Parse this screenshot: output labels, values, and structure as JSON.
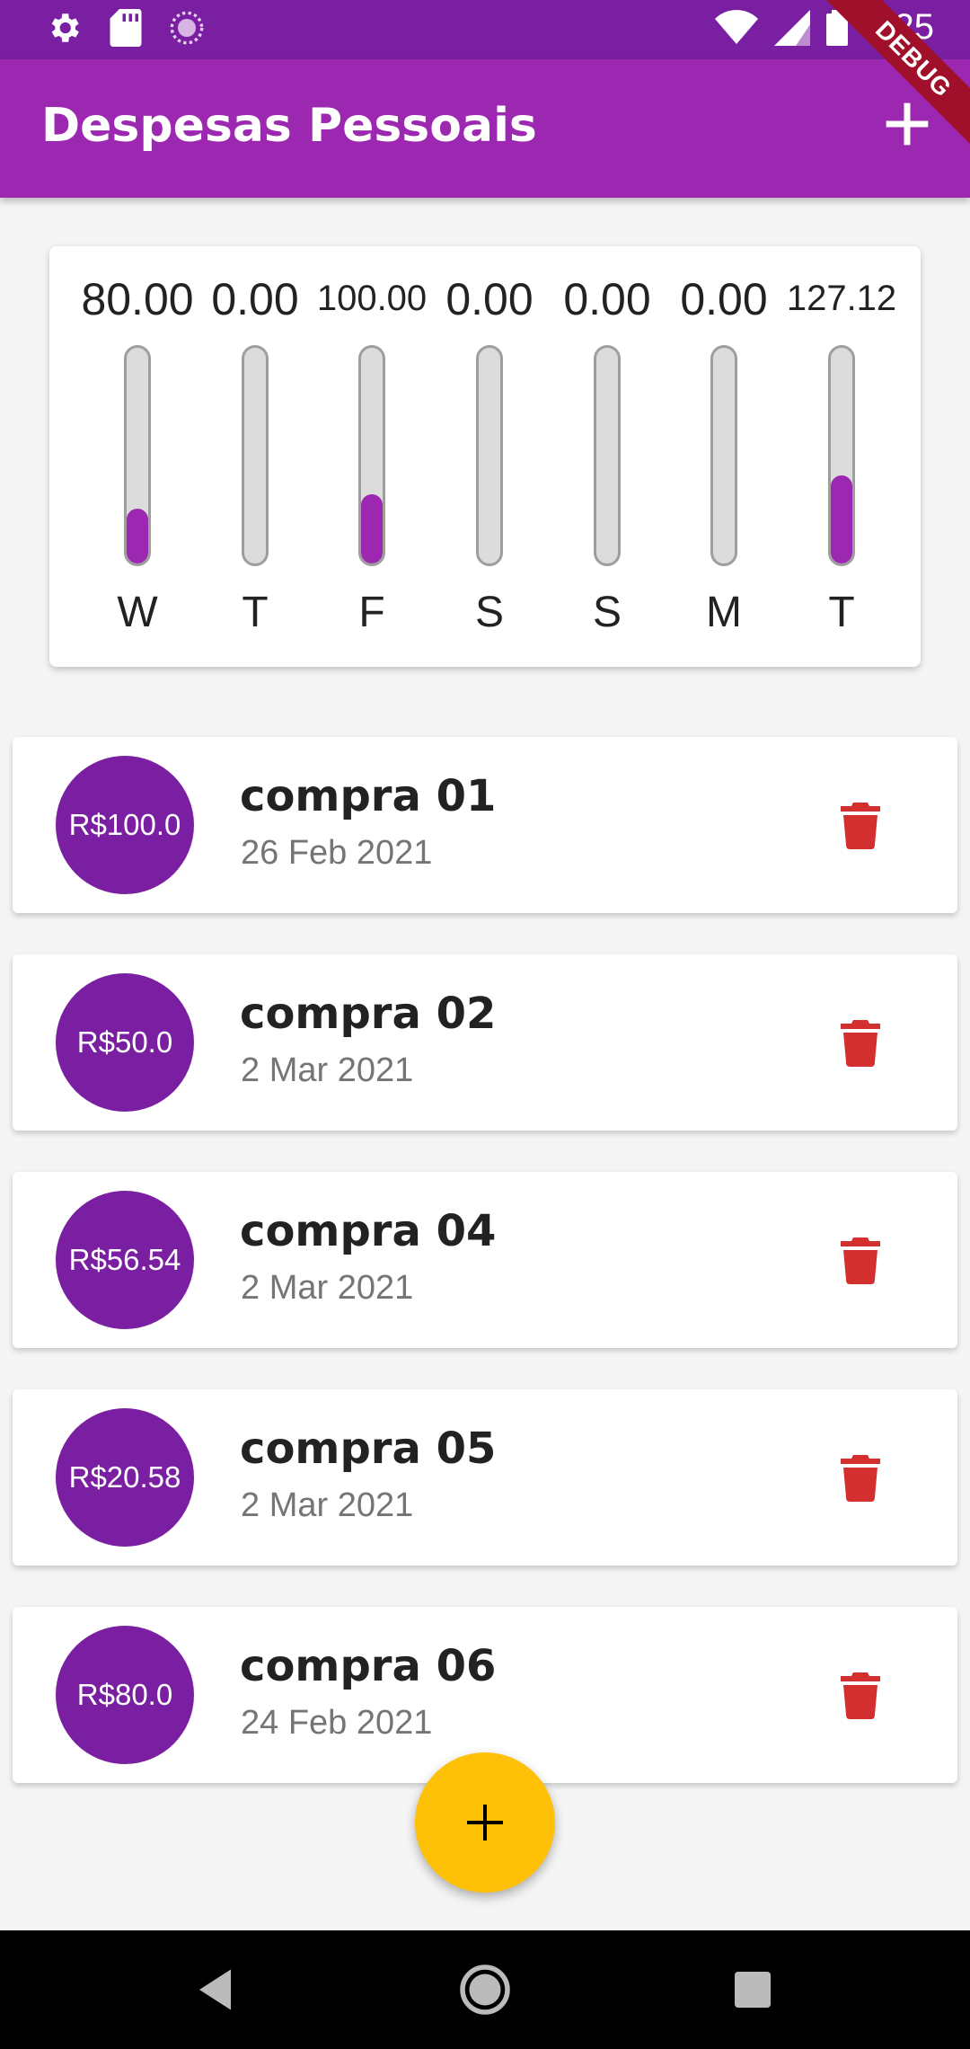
{
  "status_bar": {
    "time": "1:25",
    "icons": [
      "settings-icon",
      "sd-card-icon",
      "loading-icon",
      "wifi-icon",
      "signal-icon",
      "battery-icon"
    ]
  },
  "debug_banner": "DEBUG",
  "app_bar": {
    "title": "Despesas Pessoais",
    "action_icon": "add-icon"
  },
  "chart": {
    "bars": [
      {
        "day": "W",
        "value": "80.00",
        "fraction": 0.256
      },
      {
        "day": "T",
        "value": "0.00",
        "fraction": 0
      },
      {
        "day": "F",
        "value": "100.00",
        "fraction": 0.32
      },
      {
        "day": "S",
        "value": "0.00",
        "fraction": 0
      },
      {
        "day": "S",
        "value": "0.00",
        "fraction": 0
      },
      {
        "day": "M",
        "value": "0.00",
        "fraction": 0
      },
      {
        "day": "T",
        "value": "127.12",
        "fraction": 0.407
      }
    ],
    "fill_color": "#9c27b0"
  },
  "transactions": [
    {
      "amount": "R$100.0",
      "title": "compra 01",
      "date": "26 Feb 2021"
    },
    {
      "amount": "R$50.0",
      "title": "compra 02",
      "date": "2 Mar 2021"
    },
    {
      "amount": "R$56.54",
      "title": "compra 04",
      "date": "2 Mar 2021"
    },
    {
      "amount": "R$20.58",
      "title": "compra 05",
      "date": "2 Mar 2021"
    },
    {
      "amount": "R$80.0",
      "title": "compra 06",
      "date": "24 Feb 2021"
    }
  ],
  "fab": {
    "icon": "add-icon",
    "color": "#ffc107"
  },
  "colors": {
    "primary": "#9c27b0",
    "primary_dark": "#7b1fa2",
    "delete": "#d32f2f"
  },
  "nav": [
    "back-icon",
    "home-icon",
    "recents-icon"
  ]
}
